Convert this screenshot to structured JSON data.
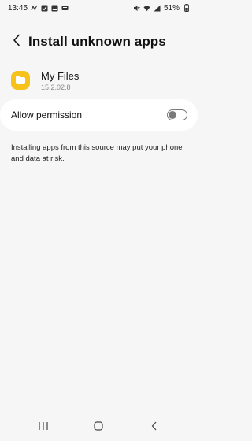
{
  "status_bar": {
    "time": "13:45",
    "battery": "51%",
    "left_icons": [
      "signal-notification-icon",
      "check-box-icon",
      "gallery-icon",
      "message-icon"
    ],
    "right_icons": [
      "mute-icon",
      "wifi-icon",
      "cell-signal-icon",
      "battery-icon"
    ]
  },
  "header": {
    "title": "Install unknown apps",
    "back_icon": "chevron-left-icon"
  },
  "app": {
    "name": "My Files",
    "version": "15.2.02.8",
    "icon": "folder-icon",
    "icon_color": "#f7c21a"
  },
  "permission": {
    "label": "Allow permission",
    "enabled": false
  },
  "warning": {
    "text": "Installing apps from this source may put your phone and data at risk."
  },
  "nav_bar": {
    "items": [
      "recent-apps-icon",
      "home-icon",
      "back-icon"
    ]
  }
}
